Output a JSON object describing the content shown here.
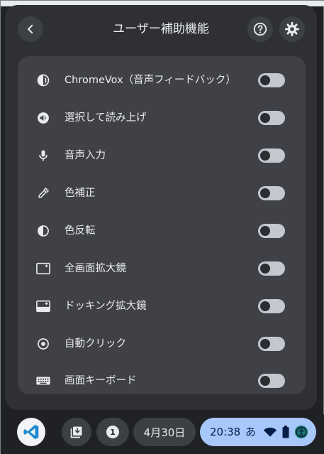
{
  "header": {
    "title": "ユーザー補助機能",
    "back_icon": "chevron-left-icon",
    "help_icon": "help-icon",
    "settings_icon": "gear-icon"
  },
  "features": [
    {
      "label": "ChromeVox（音声フィードバック）",
      "icon": "chromevox-icon",
      "enabled": false
    },
    {
      "label": "選択して読み上げ",
      "icon": "select-to-speak-icon",
      "enabled": false
    },
    {
      "label": "音声入力",
      "icon": "microphone-icon",
      "enabled": false
    },
    {
      "label": "色補正",
      "icon": "color-correction-icon",
      "enabled": false
    },
    {
      "label": "色反転",
      "icon": "color-invert-icon",
      "enabled": false
    },
    {
      "label": "全画面拡大鏡",
      "icon": "fullscreen-magnifier-icon",
      "enabled": false
    },
    {
      "label": "ドッキング拡大鏡",
      "icon": "docked-magnifier-icon",
      "enabled": false
    },
    {
      "label": "自動クリック",
      "icon": "autoclick-icon",
      "enabled": false
    },
    {
      "label": "画面キーボード",
      "icon": "keyboard-icon",
      "enabled": false
    }
  ],
  "shelf": {
    "app_icon": "vscode-icon",
    "holding_space_icon": "holding-space-icon",
    "notification_count": "1",
    "date": "4月30日",
    "time": "20:38",
    "ime": "あ",
    "colors": {
      "accent": "#a8c7fa",
      "panel": "#2e3035",
      "card": "#3f4147"
    }
  }
}
